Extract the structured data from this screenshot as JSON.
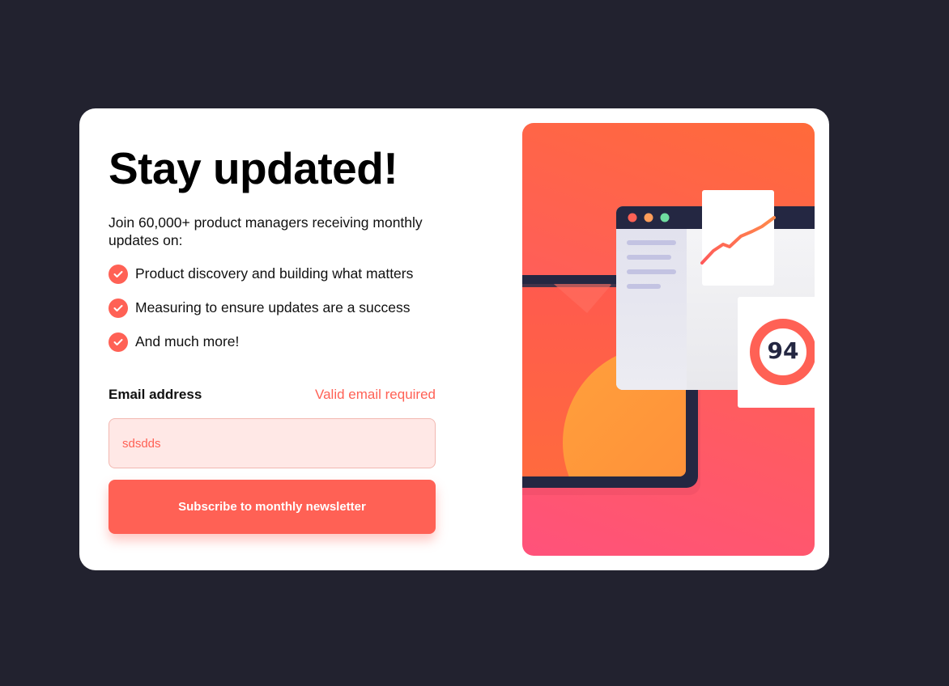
{
  "signup": {
    "title": "Stay updated!",
    "intro": "Join 60,000+ product managers receiving monthly updates on:",
    "features": [
      "Product discovery and building what matters",
      "Measuring to ensure updates are a success",
      "And much more!"
    ],
    "email_label": "Email address",
    "error_message": "Valid email required",
    "email_value": "sdsdds",
    "subscribe_label": "Subscribe to monthly newsletter"
  },
  "illustration": {
    "score": "94",
    "colors": {
      "accent": "#ff6155",
      "background": "#22222f",
      "dark_navy": "#242742"
    }
  }
}
